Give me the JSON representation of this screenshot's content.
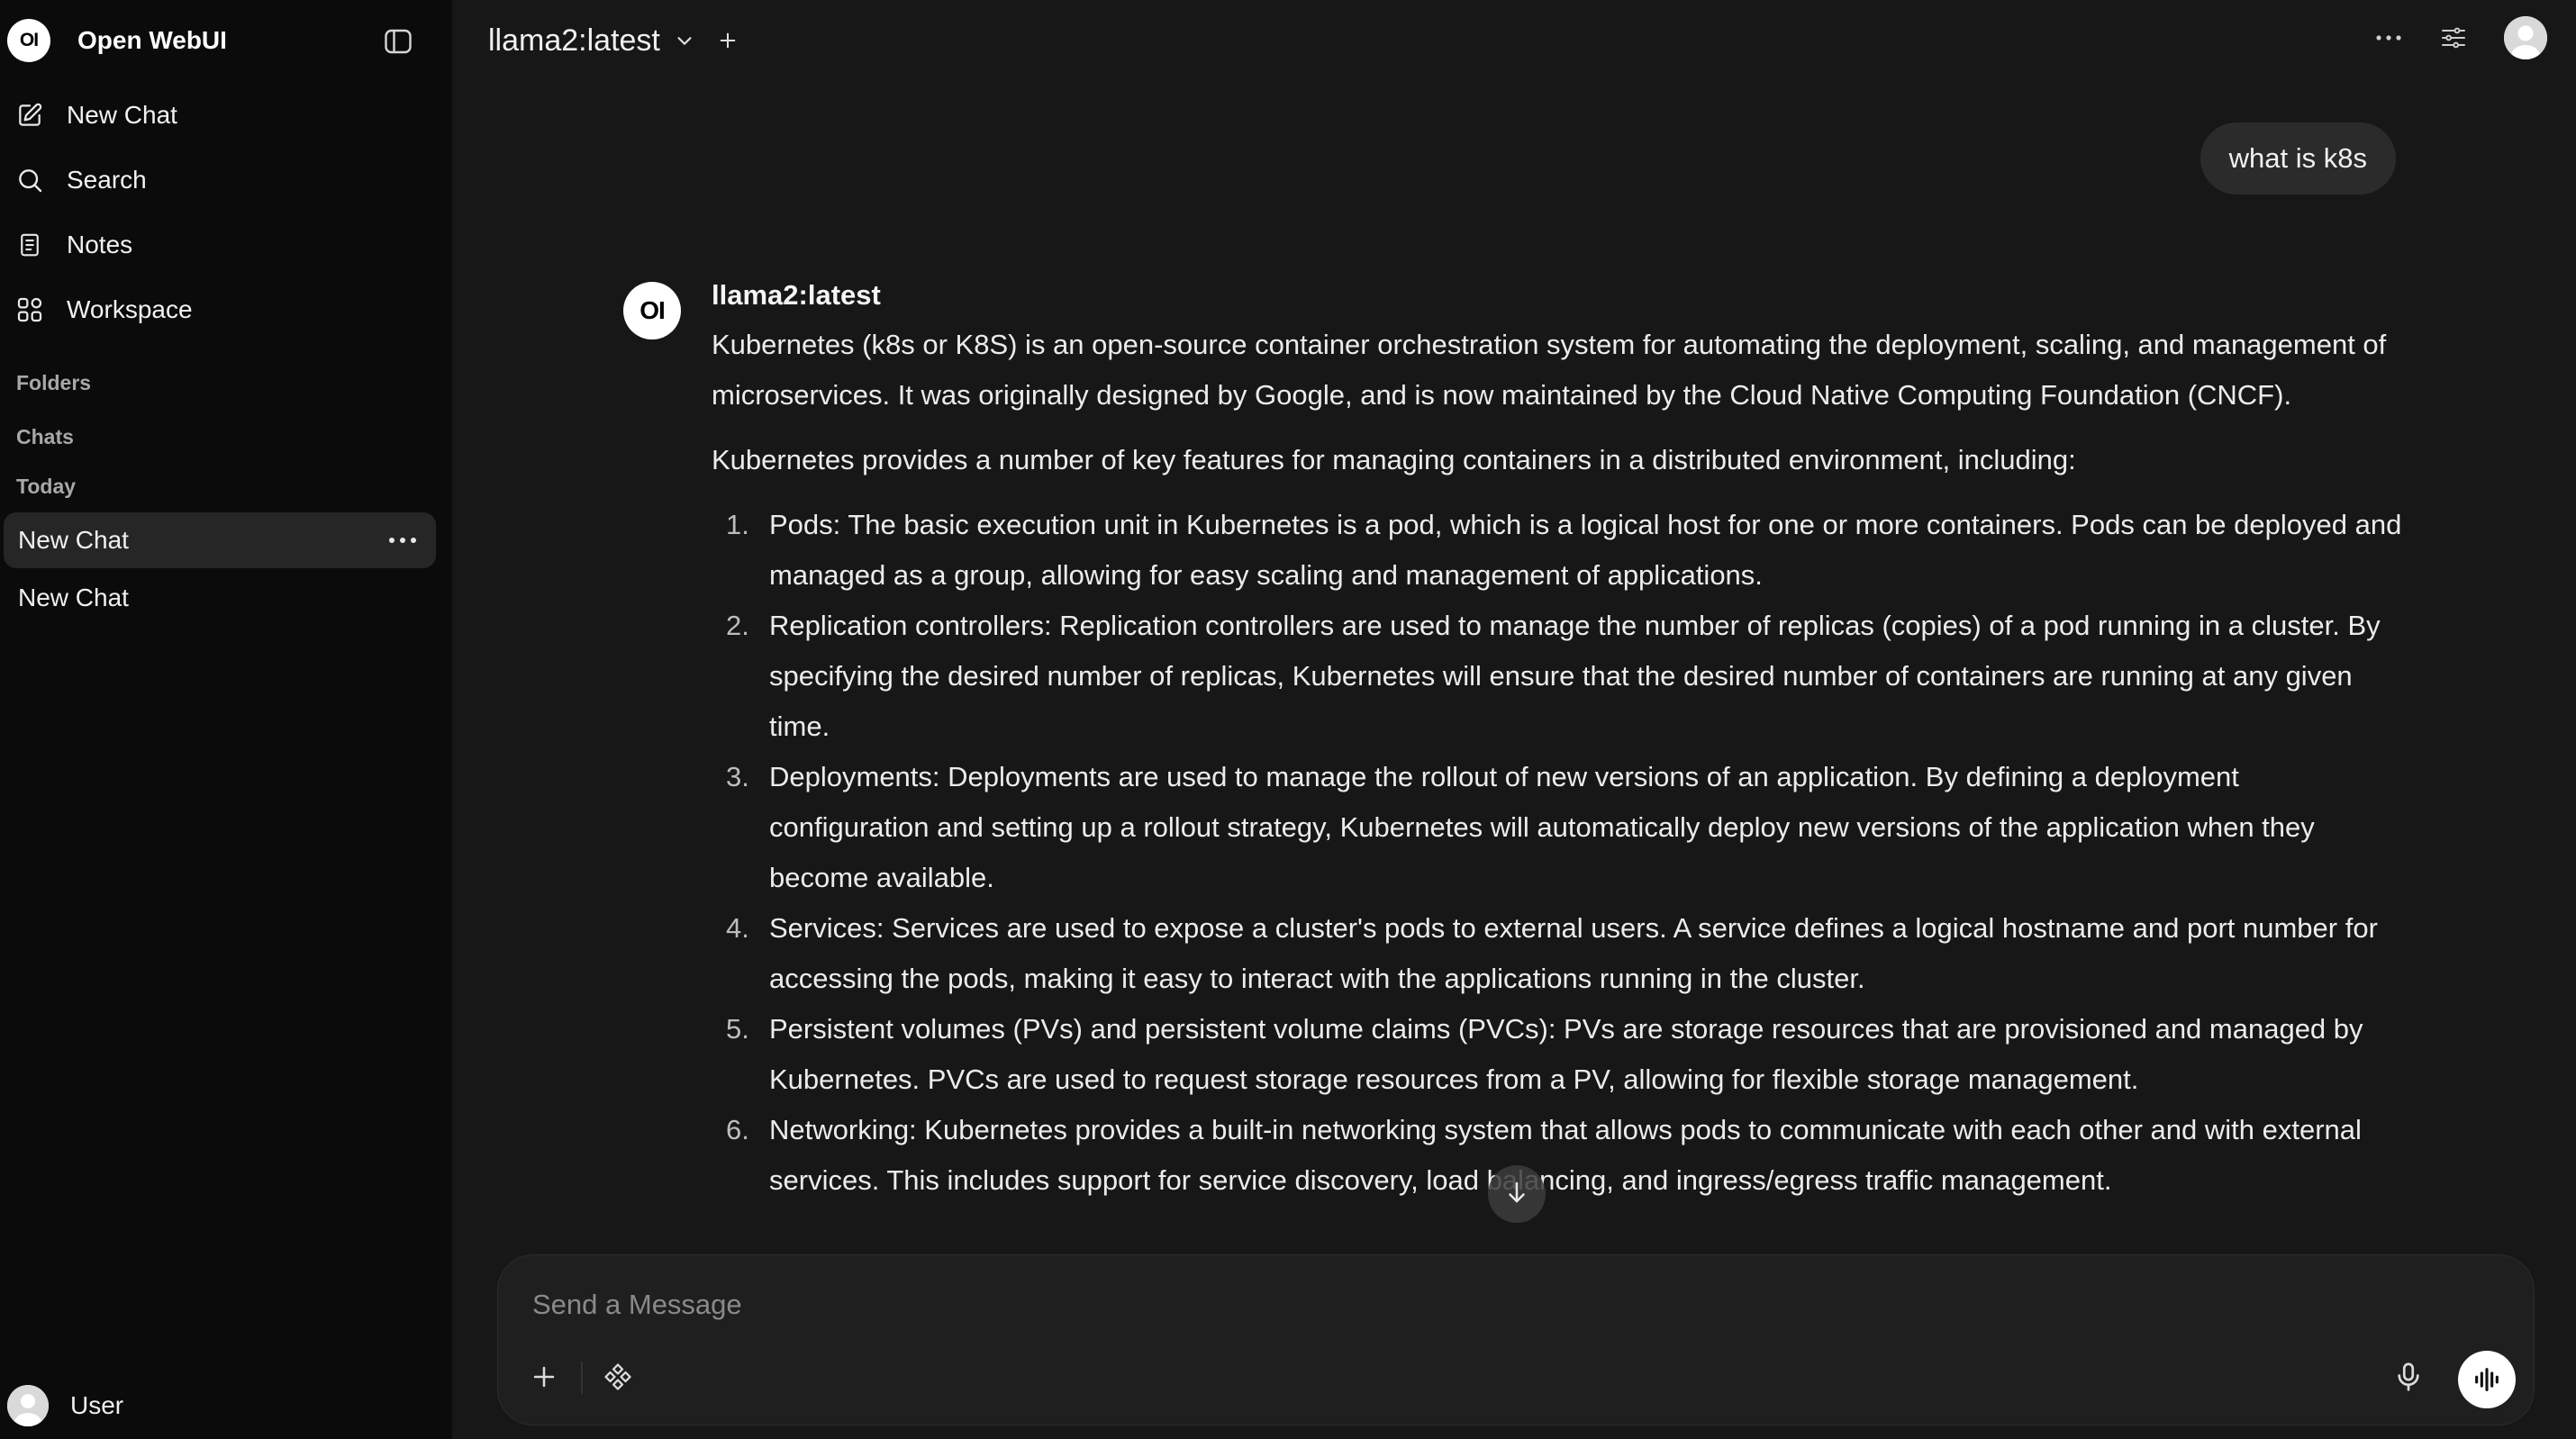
{
  "sidebar": {
    "brand": {
      "logo_text": "OI",
      "name": "Open WebUI"
    },
    "nav": [
      {
        "label": "New Chat",
        "icon": "edit-icon"
      },
      {
        "label": "Search",
        "icon": "search-icon"
      },
      {
        "label": "Notes",
        "icon": "notes-icon"
      },
      {
        "label": "Workspace",
        "icon": "workspace-icon"
      }
    ],
    "sections": {
      "folders": "Folders",
      "chats": "Chats",
      "today": "Today"
    },
    "chats": [
      {
        "title": "New Chat",
        "active": true
      },
      {
        "title": "New Chat",
        "active": false
      }
    ],
    "user": {
      "name": "User"
    }
  },
  "header": {
    "model": "llama2:latest"
  },
  "conversation": {
    "user_message": "what is k8s",
    "assistant": {
      "logo_text": "OI",
      "name": "llama2:latest",
      "intro": "Kubernetes (k8s or K8S) is an open-source container orchestration system for automating the deployment, scaling, and management of microservices. It was originally designed by Google, and is now maintained by the Cloud Native Computing Foundation (CNCF).",
      "features_intro": "Kubernetes provides a number of key features for managing containers in a distributed environment, including:",
      "points": [
        {
          "num": "1.",
          "text": "Pods: The basic execution unit in Kubernetes is a pod, which is a logical host for one or more containers. Pods can be deployed and managed as a group, allowing for easy scaling and management of applications."
        },
        {
          "num": "2.",
          "text": "Replication controllers: Replication controllers are used to manage the number of replicas (copies) of a pod running in a cluster. By specifying the desired number of replicas, Kubernetes will ensure that the desired number of containers are running at any given time."
        },
        {
          "num": "3.",
          "text": "Deployments: Deployments are used to manage the rollout of new versions of an application. By defining a deployment configuration and setting up a rollout strategy, Kubernetes will automatically deploy new versions of the application when they become available."
        },
        {
          "num": "4.",
          "text": "Services: Services are used to expose a cluster's pods to external users. A service defines a logical hostname and port number for accessing the pods, making it easy to interact with the applications running in the cluster."
        },
        {
          "num": "5.",
          "text": "Persistent volumes (PVs) and persistent volume claims (PVCs): PVs are storage resources that are provisioned and managed by Kubernetes. PVCs are used to request storage resources from a PV, allowing for flexible storage management."
        },
        {
          "num": "6.",
          "text": "Networking: Kubernetes provides a built-in networking system that allows pods to communicate with each other and with external services. This includes support for service discovery, load balancing, and ingress/egress traffic management."
        }
      ]
    }
  },
  "composer": {
    "placeholder": "Send a Message"
  },
  "colors": {
    "background": "#171717",
    "sidebar": "#0b0b0b",
    "bubble": "#2b2b2b",
    "accent": "#ffffff"
  }
}
